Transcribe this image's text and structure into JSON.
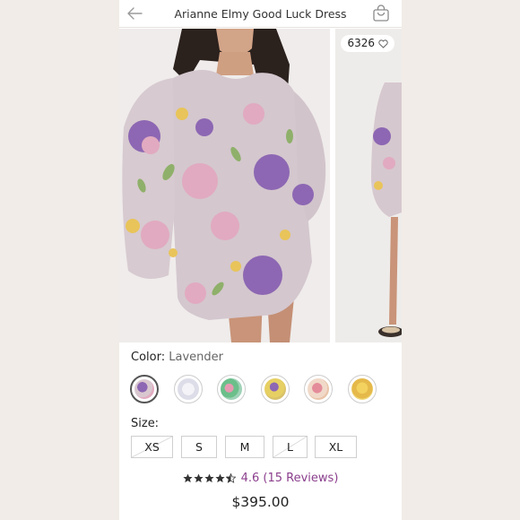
{
  "header": {
    "title": "Arianne Elmy Good Luck Dress"
  },
  "gallery": {
    "likes_count": "6326"
  },
  "color": {
    "label": "Color:",
    "selected": "Lavender",
    "swatch_count": 6,
    "selected_index": 0
  },
  "size": {
    "label": "Size:",
    "options": [
      "XS",
      "S",
      "M",
      "L",
      "XL"
    ]
  },
  "rating": {
    "value": 4.6,
    "text": "4.6 (15 Reviews)"
  },
  "price": "$395.00",
  "colors": {
    "accent": "#8b3f8d",
    "star": "#333333"
  },
  "icons": [
    "back-arrow-icon",
    "shopping-bag-icon",
    "heart-icon",
    "star-icon"
  ]
}
